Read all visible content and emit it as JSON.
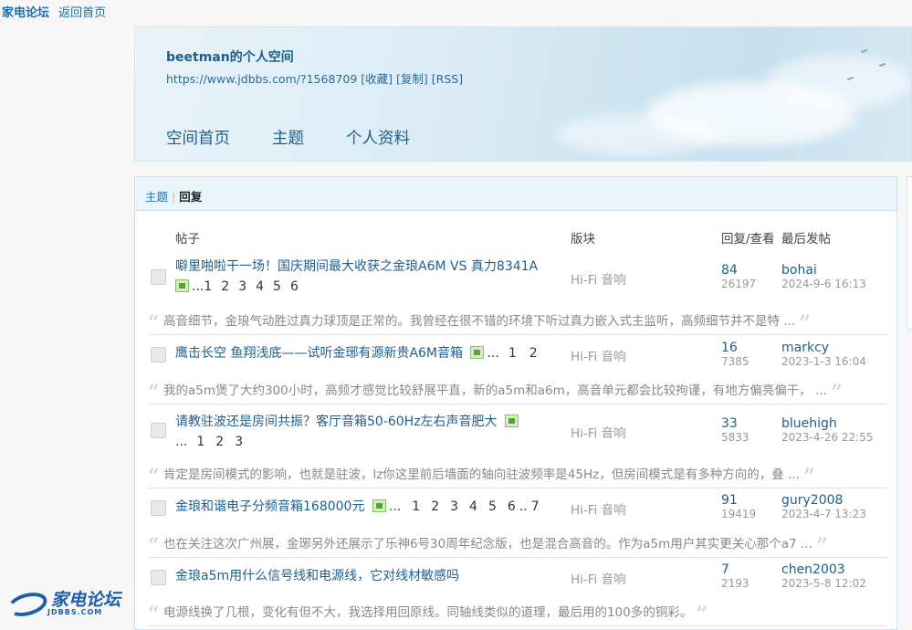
{
  "topbar": {
    "brand": "家电论坛",
    "home": "返回首页"
  },
  "space": {
    "title": "beetman的个人空间",
    "url": "https://www.jdbbs.com/?1568709",
    "actions": [
      "[收藏]",
      "[复制]",
      "[RSS]"
    ],
    "nav": [
      "空间首页",
      "主题",
      "个人资料"
    ]
  },
  "tabs": {
    "topics": "主题",
    "sep": "|",
    "replies": "回复"
  },
  "columns": {
    "post": "帖子",
    "forum": "版块",
    "stats": "回复/查看",
    "last": "最后发帖"
  },
  "threads": [
    {
      "title": "噼里啪啦干一场！国庆期间最大收获之金琅A6M VS 真力8341A",
      "pages": [
        "...",
        "1",
        "2",
        "3",
        "4",
        "5",
        "6"
      ],
      "forum": "Hi-Fi 音响",
      "replies": "84",
      "views": "26197",
      "last_user": "bohai",
      "last_time": "2024-9-6 16:13",
      "quote": "高音细节，金琅气动胜过真力球顶是正常的。我曾经在很不错的环境下听过真力嵌入式主监听，高频细节并不是特 ..."
    },
    {
      "title": "鹰击长空 鱼翔浅底——试听金琊有源新贵A6M音箱",
      "pages": [
        "...",
        "1",
        "2"
      ],
      "forum": "Hi-Fi 音响",
      "replies": "16",
      "views": "7385",
      "last_user": "markcy",
      "last_time": "2023-1-3 16:04",
      "quote": "我的a5m煲了大约300小时，高频才感觉比较舒展平直，新的a5m和a6m，高音单元都会比较拘谨，有地方偏亮偏干， ..."
    },
    {
      "title": "请教驻波还是房间共振？客厅音箱50-60Hz左右声音肥大",
      "pages": [
        "...",
        "1",
        "2",
        "3"
      ],
      "forum": "Hi-Fi 音响",
      "replies": "33",
      "views": "5833",
      "last_user": "bluehigh",
      "last_time": "2023-4-26 22:55",
      "quote": "肯定是房间模式的影响，也就是驻波，lz你这里前后墙面的轴向驻波频率是45Hz，但房间模式是有多种方向的，叠 ..."
    },
    {
      "title": "金琅和谐电子分频音箱168000元",
      "pages": [
        "...",
        "1",
        "2",
        "3",
        "4",
        "5",
        "6",
        "..",
        "7"
      ],
      "forum": "Hi-Fi 音响",
      "replies": "91",
      "views": "19419",
      "last_user": "gury2008",
      "last_time": "2023-4-7 13:23",
      "quote": "也在关注这次广州展，金琊另外还展示了乐神6号30周年纪念版，也是混合高音的。作为a5m用户其实更关心那个a7 ..."
    },
    {
      "title": "金琅a5m用什么信号线和电源线，它对线材敏感吗",
      "pages": [],
      "forum": "Hi-Fi 音响",
      "replies": "7",
      "views": "2193",
      "last_user": "chen2003",
      "last_time": "2023-5-8 12:02",
      "quote": "电源线换了几根，变化有但不大，我选择用回原线。同轴线类似的道理，最后用的100多的铜彩。"
    }
  ],
  "footer_logo": {
    "name": "家电论坛",
    "domain": "JDBBS.COM"
  },
  "colors": {
    "link": "#1f5e8c",
    "panel_header": "#eaf4fb",
    "muted": "#999999"
  },
  "icons": [
    "thread-file-icon",
    "image-attachment-icon",
    "quote-open-icon",
    "quote-close-icon"
  ]
}
